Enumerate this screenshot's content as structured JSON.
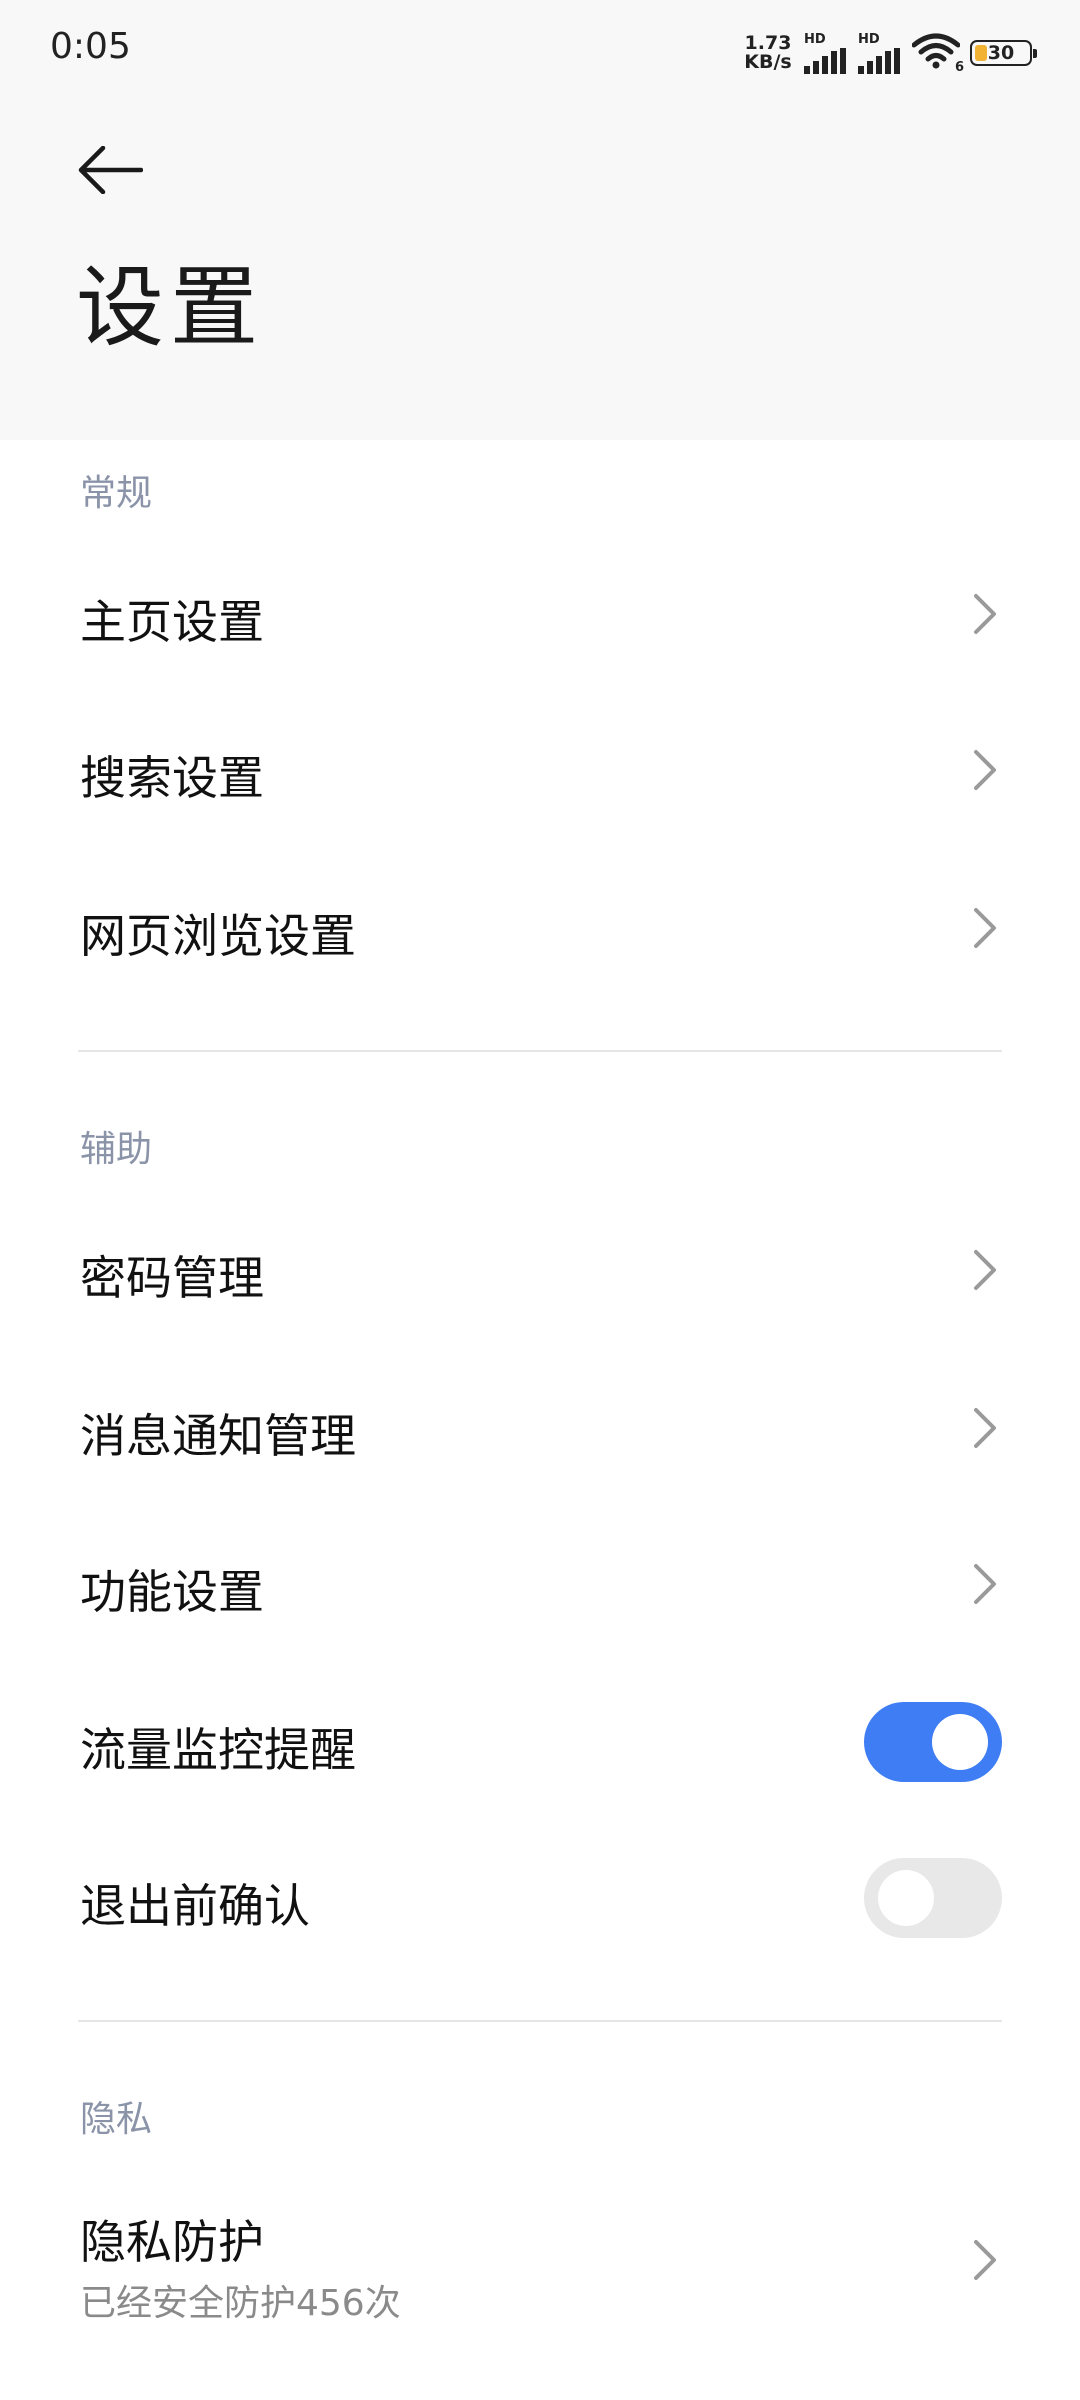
{
  "status_bar": {
    "time": "0:05",
    "net_speed_value": "1.73",
    "net_speed_unit": "KB/s",
    "sim1_label": "HD",
    "sim2_label": "HD",
    "wifi_label": "6",
    "battery": "30"
  },
  "header": {
    "title": "设置"
  },
  "sections": {
    "general": {
      "label": "常规",
      "items": [
        {
          "label": "主页设置"
        },
        {
          "label": "搜索设置"
        },
        {
          "label": "网页浏览设置"
        }
      ]
    },
    "assist": {
      "label": "辅助",
      "items": [
        {
          "label": "密码管理"
        },
        {
          "label": "消息通知管理"
        },
        {
          "label": "功能设置"
        },
        {
          "label": "流量监控提醒",
          "toggle": "on"
        },
        {
          "label": "退出前确认",
          "toggle": "off"
        }
      ]
    },
    "privacy": {
      "label": "隐私",
      "items": [
        {
          "label": "隐私防护",
          "sublabel": "已经安全防护456次"
        }
      ]
    }
  },
  "colors": {
    "accent": "#3f7df4",
    "section_label": "#8a93a8",
    "header_bg": "#f8f8f8"
  }
}
